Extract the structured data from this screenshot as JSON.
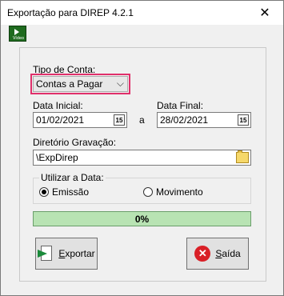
{
  "window": {
    "title": "Exportação para DIREP 4.2.1",
    "close_glyph": "✕"
  },
  "toolbar": {
    "video_label": "Vídeo"
  },
  "form": {
    "tipo_conta_label": "Tipo de Conta:",
    "tipo_conta_value": "Contas a Pagar",
    "data_inicial_label": "Data Inicial:",
    "data_inicial_value": "01/02/2021",
    "separator": "a",
    "data_final_label": "Data Final:",
    "data_final_value": "28/02/2021",
    "calendar_glyph": "15",
    "diretorio_label": "Diretório Gravação:",
    "diretorio_value": "\\ExpDirep",
    "utilizar_label": "Utilizar a Data:",
    "radio_emissao": "Emissão",
    "radio_movimento": "Movimento",
    "selected_radio": "Emissão",
    "progress_text": "0%",
    "progress_fraction": 0
  },
  "buttons": {
    "exportar_prefix": "E",
    "exportar_rest": "xportar",
    "sair_prefix": "S",
    "sair_rest": "aída"
  },
  "colors": {
    "highlight": "#e0306b",
    "progress": "#b8e3b3",
    "exit_icon": "#d91f26",
    "export_arrow": "#1a8a3a"
  }
}
